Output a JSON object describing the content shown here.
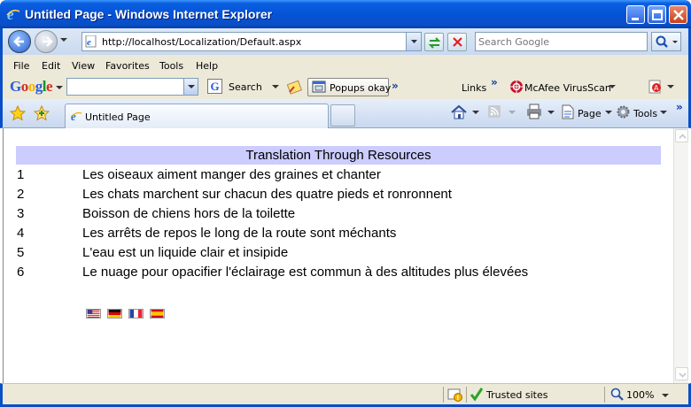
{
  "window": {
    "title": "Untitled Page - Windows Internet Explorer"
  },
  "address_bar": {
    "url": "http://localhost/Localization/Default.aspx"
  },
  "search": {
    "placeholder": "Search Google"
  },
  "menu": {
    "items": [
      "File",
      "Edit",
      "View",
      "Favorites",
      "Tools",
      "Help"
    ]
  },
  "google_toolbar": {
    "logo": "Google",
    "search_label": "Search",
    "popups_label": "Popups okay",
    "links_label": "Links",
    "mcafee_label": "McAfee VirusScan"
  },
  "tabs": [
    {
      "label": "Untitled Page"
    }
  ],
  "command_bar": {
    "page_label": "Page",
    "tools_label": "Tools"
  },
  "page": {
    "table_header": "Translation Through Resources",
    "rows": [
      {
        "num": "1",
        "text": "Les oiseaux aiment manger des graines et chanter"
      },
      {
        "num": "2",
        "text": "Les chats marchent sur chacun des quatre pieds et ronronnent"
      },
      {
        "num": "3",
        "text": "Boisson de chiens hors de la toilette"
      },
      {
        "num": "4",
        "text": "Les arrêts de repos le long de la route sont méchants"
      },
      {
        "num": "5",
        "text": "L'eau est un liquide clair et insipide"
      },
      {
        "num": "6",
        "text": "Le nuage pour opacifier l'éclairage est commun à des altitudes plus élevées"
      }
    ],
    "flags": [
      "us-flag-icon",
      "german-flag-icon",
      "french-flag-icon",
      "spanish-flag-icon"
    ]
  },
  "status_bar": {
    "zone": "Trusted sites",
    "zoom": "100%"
  },
  "colors": {
    "title_bar": "#0553d6",
    "table_header_bg": "#ccccff",
    "chrome_bg": "#ece9d8"
  }
}
